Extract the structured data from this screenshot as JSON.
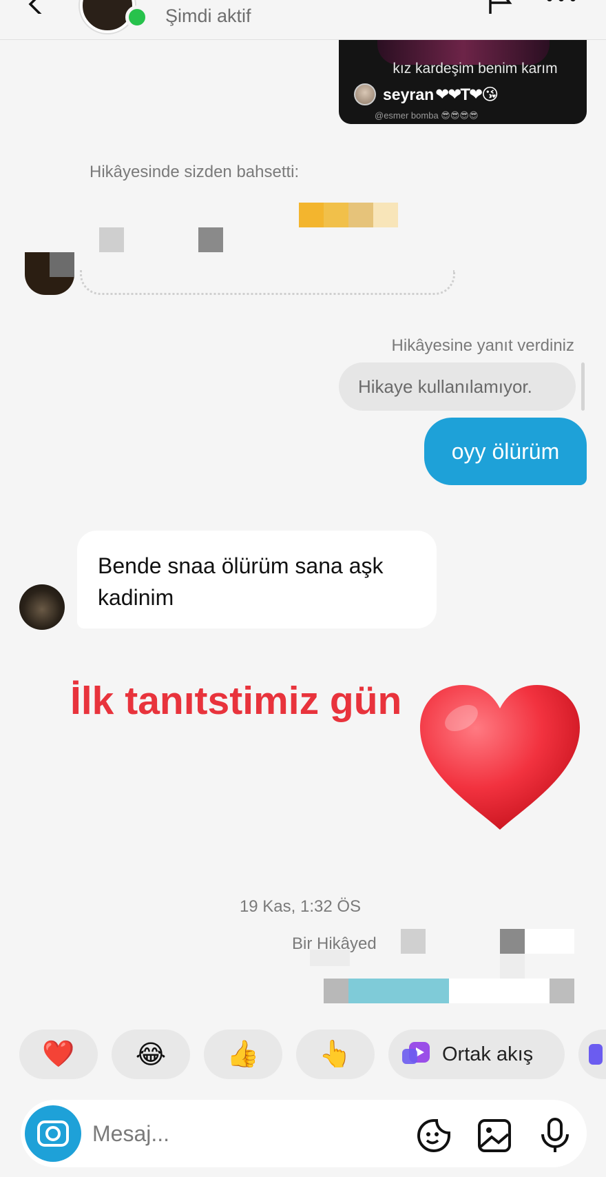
{
  "header": {
    "status": "Şimdi aktif"
  },
  "story_card": {
    "line1": "kız kardeşim benim karım",
    "line2_name": "seyran",
    "line2_hearts": "❤❤T❤😘",
    "line3": "@esmer bomba 😎😎😎😎"
  },
  "mention": {
    "label": "Hikâyesinde sizden bahsetti:"
  },
  "reply": {
    "label": "Hikâyesine yanıt verdiniz",
    "quoted": "Hikaye kullanılamıyor.",
    "sent_text": "oyy ölürüm"
  },
  "received": {
    "text": "Bende snaa ölürüm sana aşk kadinim"
  },
  "overlay": {
    "caption": "İlk tanıtstimiz gün",
    "heart_color": "#e8333c"
  },
  "timestamp": "19 Kas, 1:32 ÖS",
  "shared_label": "Bir Hikâyed",
  "reactions": [
    {
      "name": "heart",
      "glyph": "❤️"
    },
    {
      "name": "joy",
      "glyph": "😂"
    },
    {
      "name": "thumbs-up",
      "glyph": "👍"
    },
    {
      "name": "point",
      "glyph": "👆"
    }
  ],
  "ortak_label": "Ortak akış",
  "composer": {
    "placeholder": "Mesaj..."
  },
  "colors": {
    "accent": "#1ea1d8",
    "online": "#27c24c",
    "background": "#f5f5f5"
  }
}
